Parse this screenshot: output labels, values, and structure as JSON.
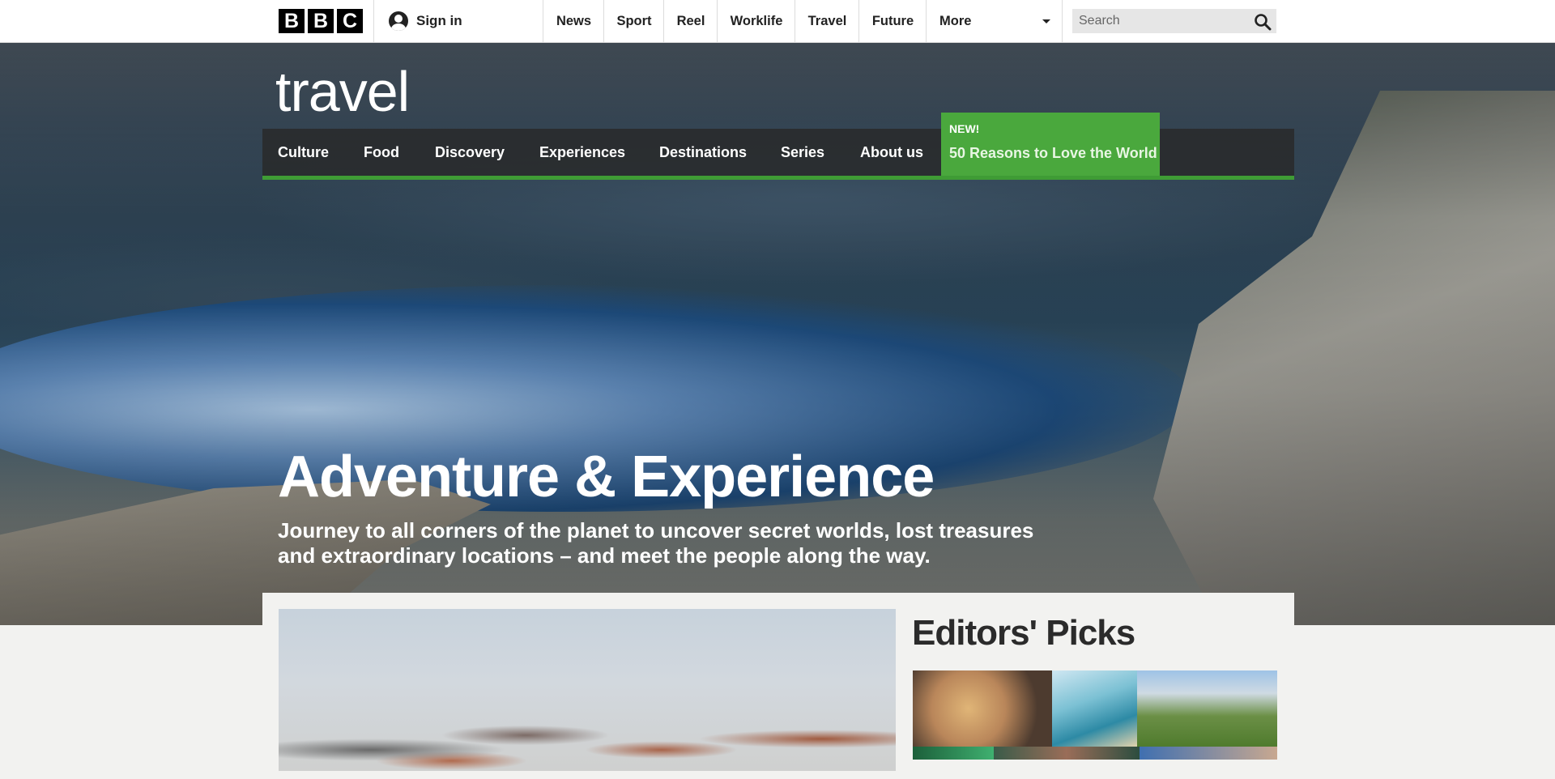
{
  "topbar": {
    "brand": [
      "B",
      "B",
      "C"
    ],
    "signin_label": "Sign in",
    "nav": [
      "News",
      "Sport",
      "Reel",
      "Worklife",
      "Travel",
      "Future",
      "More"
    ],
    "search_placeholder": "Search"
  },
  "section_logo": "travel",
  "subnav": {
    "items": [
      "Culture",
      "Food",
      "Discovery",
      "Experiences",
      "Destinations",
      "Series",
      "About us"
    ],
    "promo_badge": "NEW!",
    "promo_title": "50 Reasons to Love the World"
  },
  "hero": {
    "title": "Adventure & Experience",
    "subtitle": "Journey to all corners of the planet to uncover secret worlds, lost treasures and extraordinary locations – and meet the people along the way."
  },
  "editors_picks": {
    "title": "Editors' Picks"
  },
  "colors": {
    "accent_green": "#4aa83d",
    "subnav_border": "#3f9c35",
    "subnav_bg": "#282828"
  }
}
